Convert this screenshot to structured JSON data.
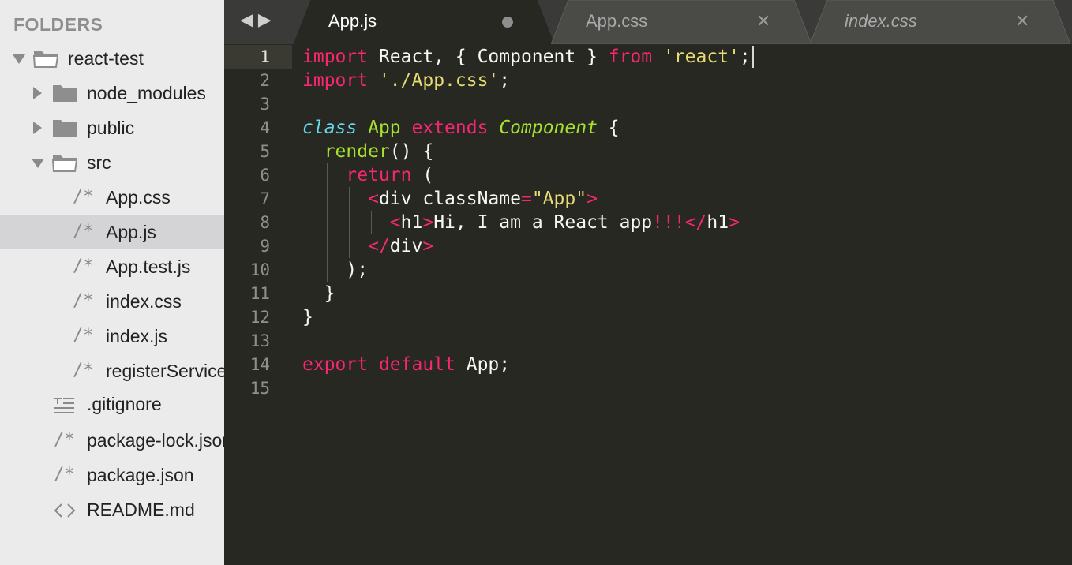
{
  "sidebar": {
    "header": "FOLDERS",
    "items": [
      {
        "label": "react-test",
        "kind": "folder-open",
        "depth": 0
      },
      {
        "label": "node_modules",
        "kind": "folder-closed",
        "depth": 1
      },
      {
        "label": "public",
        "kind": "folder-closed",
        "depth": 1
      },
      {
        "label": "src",
        "kind": "folder-open",
        "depth": 1
      },
      {
        "label": "App.css",
        "kind": "file",
        "depth": 2,
        "glyph": "/*"
      },
      {
        "label": "App.js",
        "kind": "file",
        "depth": 2,
        "glyph": "/*",
        "selected": true
      },
      {
        "label": "App.test.js",
        "kind": "file",
        "depth": 2,
        "glyph": "/*"
      },
      {
        "label": "index.css",
        "kind": "file",
        "depth": 2,
        "glyph": "/*"
      },
      {
        "label": "index.js",
        "kind": "file",
        "depth": 2,
        "glyph": "/*"
      },
      {
        "label": "registerServiceWorker.js",
        "kind": "file",
        "depth": 2,
        "glyph": "/*"
      },
      {
        "label": ".gitignore",
        "kind": "file",
        "depth": 1,
        "glyph": "lines"
      },
      {
        "label": "package-lock.json",
        "kind": "file",
        "depth": 1,
        "glyph": "/*"
      },
      {
        "label": "package.json",
        "kind": "file",
        "depth": 1,
        "glyph": "/*"
      },
      {
        "label": "README.md",
        "kind": "file",
        "depth": 1,
        "glyph": "<>"
      }
    ]
  },
  "tabs": {
    "nav_back_icon": "chevron-left-icon",
    "nav_forward_icon": "chevron-right-icon",
    "items": [
      {
        "title": "App.js",
        "active": true,
        "dirty": true
      },
      {
        "title": "App.css",
        "active": false,
        "dirty": false
      },
      {
        "title": "index.css",
        "active": false,
        "dirty": false,
        "italic": true
      }
    ]
  },
  "editor": {
    "active_line": 1,
    "line_numbers": [
      "1",
      "2",
      "3",
      "4",
      "5",
      "6",
      "7",
      "8",
      "9",
      "10",
      "11",
      "12",
      "13",
      "14",
      "15"
    ],
    "lines": [
      [
        [
          "kw",
          "import"
        ],
        [
          "pl",
          " React, { Component } "
        ],
        [
          "kw",
          "from"
        ],
        [
          "pl",
          " "
        ],
        [
          "str",
          "'react'"
        ],
        [
          "pl",
          ";"
        ]
      ],
      [
        [
          "kw",
          "import"
        ],
        [
          "pl",
          " "
        ],
        [
          "str",
          "'./App.css'"
        ],
        [
          "pl",
          ";"
        ]
      ],
      [],
      [
        [
          "cls",
          "class"
        ],
        [
          "pl",
          " "
        ],
        [
          "ent",
          "App"
        ],
        [
          "pl",
          " "
        ],
        [
          "kw",
          "extends"
        ],
        [
          "pl",
          " "
        ],
        [
          "inh",
          "Component"
        ],
        [
          "pl",
          " {"
        ]
      ],
      [
        [
          "pl",
          "  "
        ],
        [
          "ent",
          "render"
        ],
        [
          "pl",
          "() {"
        ]
      ],
      [
        [
          "pl",
          "    "
        ],
        [
          "kw",
          "return"
        ],
        [
          "pl",
          " ("
        ]
      ],
      [
        [
          "pl",
          "      "
        ],
        [
          "tag",
          "<"
        ],
        [
          "pl",
          "div "
        ],
        [
          "attr",
          "className"
        ],
        [
          "tag",
          "="
        ],
        [
          "str",
          "\"App\""
        ],
        [
          "tag",
          ">"
        ]
      ],
      [
        [
          "pl",
          "        "
        ],
        [
          "tag",
          "<"
        ],
        [
          "pl",
          "h1"
        ],
        [
          "tag",
          ">"
        ],
        [
          "pl",
          "Hi, I am a React app"
        ],
        [
          "tag",
          "!!!</"
        ],
        [
          "pl",
          "h1"
        ],
        [
          "tag",
          ">"
        ]
      ],
      [
        [
          "pl",
          "      "
        ],
        [
          "tag",
          "</"
        ],
        [
          "pl",
          "div"
        ],
        [
          "tag",
          ">"
        ]
      ],
      [
        [
          "pl",
          "    );"
        ]
      ],
      [
        [
          "pl",
          "  }"
        ]
      ],
      [
        [
          "pl",
          "}"
        ]
      ],
      [],
      [
        [
          "kw",
          "export"
        ],
        [
          "pl",
          " "
        ],
        [
          "kw",
          "default"
        ],
        [
          "pl",
          " App;"
        ]
      ],
      []
    ]
  },
  "colors": {
    "sidebar_bg": "#ebebeb",
    "selected_row": "#d4d4d6",
    "editor_bg": "#272822",
    "tabbar_bg": "#3a3a38",
    "keyword": "#f92672",
    "string": "#e6db74",
    "entity": "#a6e22e",
    "storage": "#66d9ef"
  }
}
